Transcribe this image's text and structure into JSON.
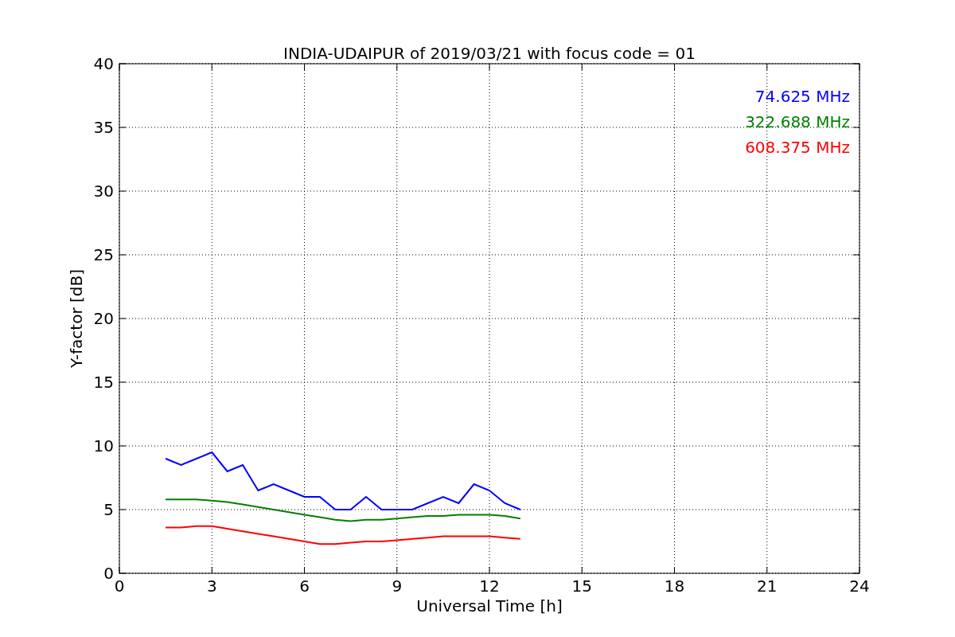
{
  "chart_data": {
    "type": "line",
    "title": "INDIA-UDAIPUR of 2019/03/21 with focus code = 01",
    "xlabel": "Universal Time [h]",
    "ylabel": "Y-factor [dB]",
    "x": [
      1.5,
      2,
      2.5,
      3,
      3.5,
      4,
      4.5,
      5,
      5.5,
      6,
      6.5,
      7,
      7.5,
      8,
      8.5,
      9,
      9.5,
      10,
      10.5,
      11,
      11.5,
      12,
      12.5,
      13
    ],
    "series": [
      {
        "name": "74.625 MHz",
        "color": "#0000ff",
        "values": [
          9,
          8.5,
          9,
          9.5,
          8,
          8.5,
          6.5,
          7,
          6.5,
          6,
          6,
          5,
          5,
          6,
          5,
          5,
          5,
          5.5,
          6,
          5.5,
          7,
          6.5,
          5.5,
          5
        ]
      },
      {
        "name": "322.688 MHz",
        "color": "#008000",
        "values": [
          5.8,
          5.8,
          5.8,
          5.7,
          5.6,
          5.4,
          5.2,
          5,
          4.8,
          4.6,
          4.4,
          4.2,
          4.1,
          4.2,
          4.2,
          4.3,
          4.4,
          4.5,
          4.5,
          4.6,
          4.6,
          4.6,
          4.5,
          4.3
        ]
      },
      {
        "name": "608.375 MHz",
        "color": "#ff0000",
        "values": [
          3.6,
          3.6,
          3.7,
          3.7,
          3.5,
          3.3,
          3.1,
          2.9,
          2.7,
          2.5,
          2.3,
          2.3,
          2.4,
          2.5,
          2.5,
          2.6,
          2.7,
          2.8,
          2.9,
          2.9,
          2.9,
          2.9,
          2.8,
          2.7
        ]
      }
    ],
    "grid": true,
    "xlim": [
      0,
      24
    ],
    "ylim": [
      0,
      40
    ],
    "xticks": [
      0,
      3,
      6,
      9,
      12,
      15,
      18,
      21,
      24
    ],
    "yticks": [
      0,
      5,
      10,
      15,
      20,
      25,
      30,
      35,
      40
    ]
  }
}
